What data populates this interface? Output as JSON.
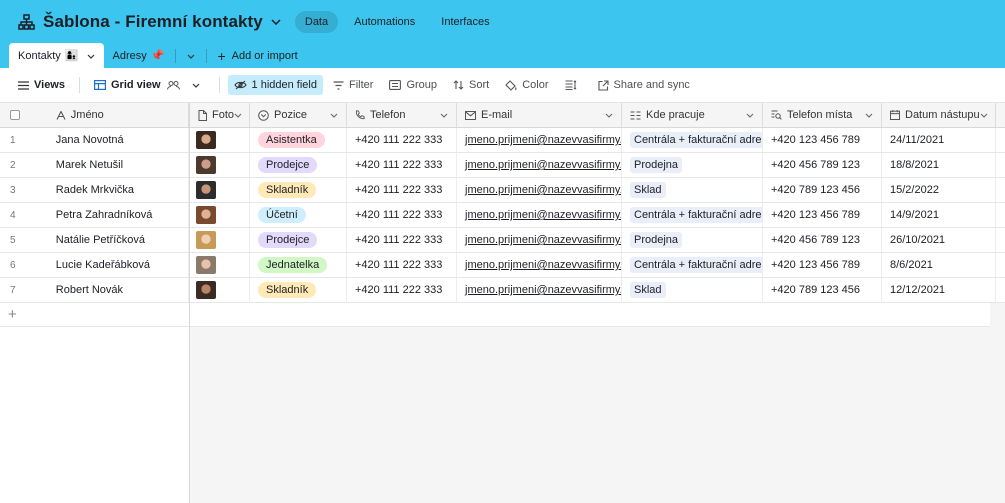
{
  "app": {
    "title": "Šablona - Firemní kontakty",
    "top_tabs": [
      {
        "label": "Data",
        "active": true
      },
      {
        "label": "Automations",
        "active": false
      },
      {
        "label": "Interfaces",
        "active": false
      }
    ],
    "accent_color": "#3cc6ef"
  },
  "tables": {
    "tabs": [
      {
        "label": "Kontakty",
        "emoji": "👩‍👦",
        "active": true
      },
      {
        "label": "Adresy",
        "emoji": "📌",
        "active": false
      }
    ],
    "add_import": "Add or import"
  },
  "toolbar": {
    "views": "Views",
    "grid_view": "Grid view",
    "hidden_field": "1 hidden field",
    "filter": "Filter",
    "group": "Group",
    "sort": "Sort",
    "color": "Color",
    "share_sync": "Share and sync"
  },
  "columns": {
    "name": "Jméno",
    "foto": "Foto",
    "pozice": "Pozice",
    "telefon": "Telefon",
    "email": "E-mail",
    "kde": "Kde pracuje",
    "telefon_mista": "Telefon místa",
    "datum": "Datum nástupu"
  },
  "pill_colors": {
    "Asistentka": "#ffd4dd",
    "Prodejce": "#e2d9fb",
    "Skladník": "#ffe9b6",
    "Účetní": "#cfeefd",
    "Jednatelka": "#d1f7c4"
  },
  "rows": [
    {
      "num": "1",
      "name": "Jana Novotná",
      "foto": "avatar-woman-dark-hair",
      "pozice": "Asistentka",
      "telefon": "+420 111 222 333",
      "email": "jmeno.prijmeni@nazevvasifirmy.cz",
      "kde": "Centrála + fakturační adresa",
      "telefon_mista": "+420 123 456 789",
      "datum": "24/11/2021"
    },
    {
      "num": "2",
      "name": "Marek Netušil",
      "foto": "avatar-man",
      "pozice": "Prodejce",
      "telefon": "+420 111 222 333",
      "email": "jmeno.prijmeni@nazevvasifirmy.cz",
      "kde": "Prodejna",
      "telefon_mista": "+420 456 789 123",
      "datum": "18/8/2021"
    },
    {
      "num": "3",
      "name": "Radek Mrkvička",
      "foto": "avatar-man-sunglasses",
      "pozice": "Skladník",
      "telefon": "+420 111 222 333",
      "email": "jmeno.prijmeni@nazevvasifirmy.cz",
      "kde": "Sklad",
      "telefon_mista": "+420 789 123 456",
      "datum": "15/2/2022"
    },
    {
      "num": "4",
      "name": "Petra Zahradníková",
      "foto": "avatar-woman",
      "pozice": "Účetní",
      "telefon": "+420 111 222 333",
      "email": "jmeno.prijmeni@nazevvasifirmy.cz",
      "kde": "Centrála + fakturační adresa",
      "telefon_mista": "+420 123 456 789",
      "datum": "14/9/2021"
    },
    {
      "num": "5",
      "name": "Natálie Petříčková",
      "foto": "avatar-woman-blonde",
      "pozice": "Prodejce",
      "telefon": "+420 111 222 333",
      "email": "jmeno.prijmeni@nazevvasifirmy.cz",
      "kde": "Prodejna",
      "telefon_mista": "+420 456 789 123",
      "datum": "26/10/2021"
    },
    {
      "num": "6",
      "name": "Lucie Kadeřábková",
      "foto": "avatar-woman-light",
      "pozice": "Jednatelka",
      "telefon": "+420 111 222 333",
      "email": "jmeno.prijmeni@nazevvasifirmy.cz",
      "kde": "Centrála + fakturační adresa",
      "telefon_mista": "+420 123 456 789",
      "datum": "8/6/2021"
    },
    {
      "num": "7",
      "name": "Robert Novák",
      "foto": "avatar-man-dark",
      "pozice": "Skladník",
      "telefon": "+420 111 222 333",
      "email": "jmeno.prijmeni@nazevvasifirmy.cz",
      "kde": "Sklad",
      "telefon_mista": "+420 789 123 456",
      "datum": "12/12/2021"
    }
  ]
}
